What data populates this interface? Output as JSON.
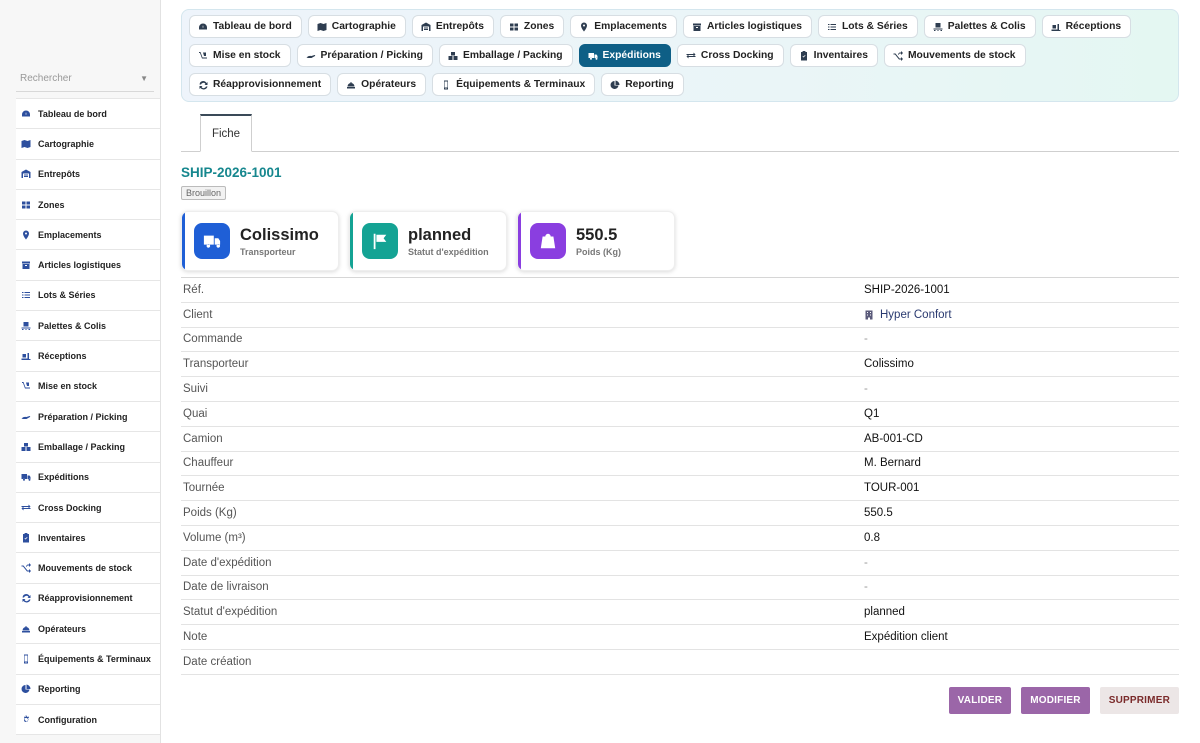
{
  "sidebar": {
    "search_placeholder": "Rechercher",
    "items": [
      {
        "label": "Tableau de bord",
        "icon": "dashboard-icon"
      },
      {
        "label": "Cartographie",
        "icon": "map-icon"
      },
      {
        "label": "Entrepôts",
        "icon": "warehouse-icon"
      },
      {
        "label": "Zones",
        "icon": "grid-icon"
      },
      {
        "label": "Emplacements",
        "icon": "pin-icon"
      },
      {
        "label": "Articles logistiques",
        "icon": "box-icon"
      },
      {
        "label": "Lots & Séries",
        "icon": "list-icon"
      },
      {
        "label": "Palettes & Colis",
        "icon": "pallet-icon"
      },
      {
        "label": "Réceptions",
        "icon": "truck-loading-icon"
      },
      {
        "label": "Mise en stock",
        "icon": "dolly-icon"
      },
      {
        "label": "Préparation / Picking",
        "icon": "hand-icon"
      },
      {
        "label": "Emballage / Packing",
        "icon": "boxes-icon"
      },
      {
        "label": "Expéditions",
        "icon": "truck-icon"
      },
      {
        "label": "Cross Docking",
        "icon": "exchange-icon"
      },
      {
        "label": "Inventaires",
        "icon": "clipboard-icon"
      },
      {
        "label": "Mouvements de stock",
        "icon": "shuffle-icon"
      },
      {
        "label": "Réapprovisionnement",
        "icon": "sync-icon"
      },
      {
        "label": "Opérateurs",
        "icon": "hardhat-icon"
      },
      {
        "label": "Équipements & Terminaux",
        "icon": "mobile-icon"
      },
      {
        "label": "Reporting",
        "icon": "pie-chart-icon"
      },
      {
        "label": "Configuration",
        "icon": "gear-icon"
      }
    ]
  },
  "topnav": {
    "tabs": [
      {
        "label": "Tableau de bord",
        "icon": "dashboard-icon",
        "active": false
      },
      {
        "label": "Cartographie",
        "icon": "map-icon",
        "active": false
      },
      {
        "label": "Entrepôts",
        "icon": "warehouse-icon",
        "active": false
      },
      {
        "label": "Zones",
        "icon": "grid-icon",
        "active": false
      },
      {
        "label": "Emplacements",
        "icon": "pin-icon",
        "active": false
      },
      {
        "label": "Articles logistiques",
        "icon": "box-icon",
        "active": false
      },
      {
        "label": "Lots & Séries",
        "icon": "list-icon",
        "active": false
      },
      {
        "label": "Palettes & Colis",
        "icon": "pallet-icon",
        "active": false
      },
      {
        "label": "Réceptions",
        "icon": "truck-loading-icon",
        "active": false
      },
      {
        "label": "Mise en stock",
        "icon": "dolly-icon",
        "active": false
      },
      {
        "label": "Préparation / Picking",
        "icon": "hand-icon",
        "active": false
      },
      {
        "label": "Emballage / Packing",
        "icon": "boxes-icon",
        "active": false
      },
      {
        "label": "Expéditions",
        "icon": "truck-icon",
        "active": true
      },
      {
        "label": "Cross Docking",
        "icon": "exchange-icon",
        "active": false
      },
      {
        "label": "Inventaires",
        "icon": "clipboard-icon",
        "active": false
      },
      {
        "label": "Mouvements de stock",
        "icon": "shuffle-icon",
        "active": false
      },
      {
        "label": "Réapprovisionnement",
        "icon": "sync-icon",
        "active": false
      },
      {
        "label": "Opérateurs",
        "icon": "hardhat-icon",
        "active": false
      },
      {
        "label": "Équipements & Terminaux",
        "icon": "mobile-icon",
        "active": false
      },
      {
        "label": "Reporting",
        "icon": "pie-chart-icon",
        "active": false
      }
    ]
  },
  "subtab": {
    "label": "Fiche"
  },
  "record": {
    "title": "SHIP-2026-1001",
    "status": "Brouillon"
  },
  "cards": [
    {
      "value": "Colissimo",
      "label": "Transporteur",
      "icon": "truck-icon",
      "color": "#1f5fd6"
    },
    {
      "value": "planned",
      "label": "Statut d'expédition",
      "icon": "flag-icon",
      "color": "#14a394"
    },
    {
      "value": "550.5",
      "label": "Poids (Kg)",
      "icon": "weight-icon",
      "color": "#8a3ee0"
    }
  ],
  "details": [
    {
      "key": "Réf.",
      "value": "SHIP-2026-1001"
    },
    {
      "key": "Client",
      "value": "Hyper Confort",
      "icon": "building-icon"
    },
    {
      "key": "Commande",
      "value": "-"
    },
    {
      "key": "Transporteur",
      "value": "Colissimo"
    },
    {
      "key": "Suivi",
      "value": "-"
    },
    {
      "key": "Quai",
      "value": "Q1"
    },
    {
      "key": "Camion",
      "value": "AB-001-CD"
    },
    {
      "key": "Chauffeur",
      "value": "M. Bernard"
    },
    {
      "key": "Tournée",
      "value": "TOUR-001"
    },
    {
      "key": "Poids (Kg)",
      "value": "550.5"
    },
    {
      "key": "Volume (m³)",
      "value": "0.8"
    },
    {
      "key": "Date d'expédition",
      "value": "-"
    },
    {
      "key": "Date de livraison",
      "value": "-"
    },
    {
      "key": "Statut d'expédition",
      "value": "planned"
    },
    {
      "key": "Note",
      "value": "Expédition client"
    },
    {
      "key": "Date création",
      "value": ""
    }
  ],
  "actions": {
    "validate": "VALIDER",
    "modify": "MODIFIER",
    "delete": "SUPPRIMER"
  }
}
